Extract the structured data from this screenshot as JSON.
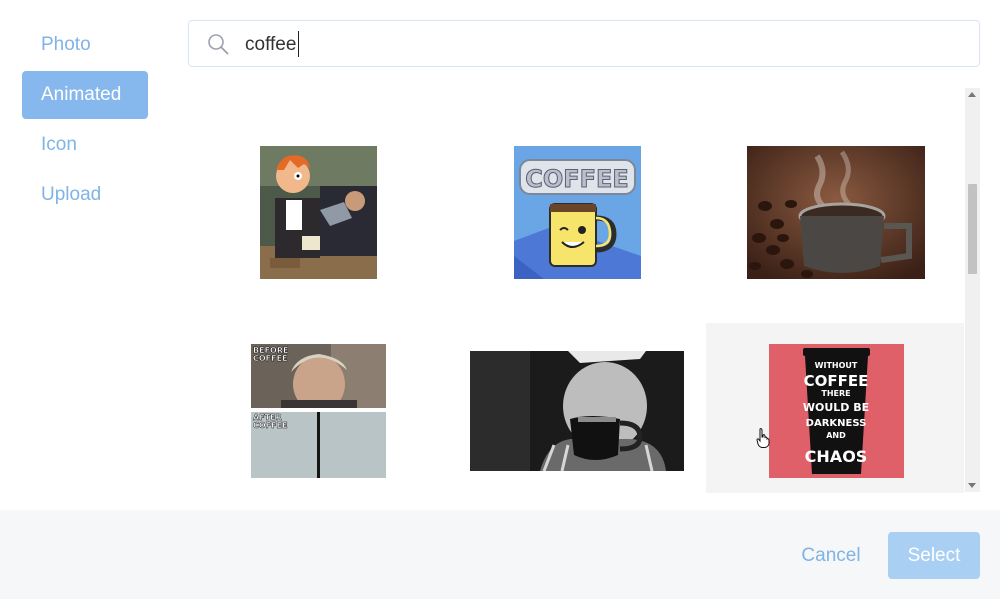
{
  "sidebar": {
    "items": [
      {
        "label": "Photo",
        "active": false
      },
      {
        "label": "Animated",
        "active": true
      },
      {
        "label": "Icon",
        "active": false
      },
      {
        "label": "Upload",
        "active": false
      }
    ]
  },
  "search": {
    "value": "coffee",
    "icon": "search-icon"
  },
  "results": {
    "items": [
      {
        "name": "futurama-coffee-gif"
      },
      {
        "name": "coffee-cartoon-mug-gif"
      },
      {
        "name": "steaming-coffee-cup-gif"
      },
      {
        "name": "before-after-coffee-gif",
        "text_lines": [
          "BEFORE",
          "COFFEE",
          "AFTER",
          "COFFEE"
        ]
      },
      {
        "name": "man-drinking-coffee-pot-gif"
      },
      {
        "name": "without-coffee-chaos-gif",
        "text_lines": [
          "WITHOUT",
          "COFFEE",
          "THERE",
          "WOULD BE",
          "DARKNESS",
          "AND",
          "CHAOS"
        ]
      }
    ],
    "hovered_index": 5
  },
  "footer": {
    "cancel_label": "Cancel",
    "select_label": "Select"
  },
  "colors": {
    "accent": "#86b8ee",
    "link": "#7fb4e6",
    "select_disabled": "#a9cff2"
  }
}
